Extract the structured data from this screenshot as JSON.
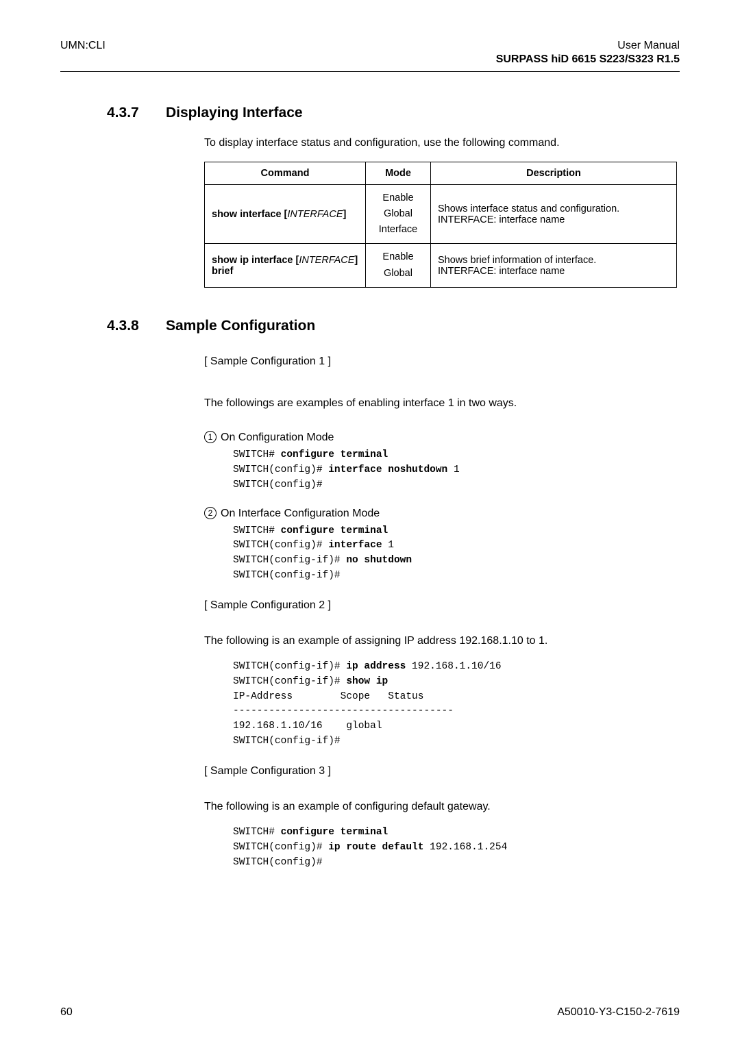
{
  "header": {
    "left": "UMN:CLI",
    "right_top": "User Manual",
    "right_sub": "SURPASS hiD 6615 S223/S323 R1.5"
  },
  "s437": {
    "num": "4.3.7",
    "title": "Displaying Interface",
    "intro": "To display interface status and configuration, use the following command.",
    "th_cmd": "Command",
    "th_mode": "Mode",
    "th_desc": "Description",
    "rows": [
      {
        "cmd_pre": "show interface",
        "cmd_param": "INTERFACE",
        "mode1": "Enable",
        "mode2": "Global",
        "mode3": "Interface",
        "desc1": "Shows interface status and configuration.",
        "desc2": "INTERFACE: interface name"
      },
      {
        "cmd_pre1": "show ip interface",
        "cmd_param": "INTERFACE",
        "cmd_post": "brief",
        "mode1": "Enable",
        "mode2": "Global",
        "desc1": "Shows brief information of interface.",
        "desc2": "INTERFACE: interface name"
      }
    ]
  },
  "s438": {
    "num": "4.3.8",
    "title": "Sample Configuration",
    "s1_label": "[ Sample Configuration 1 ]",
    "s1_intro": "The followings are examples of enabling interface 1 in two ways.",
    "step1_label": "On Configuration Mode",
    "step1_code": {
      "l1p": "SWITCH# ",
      "l1b": "configure terminal",
      "l2p": "SWITCH(config)# ",
      "l2b": "interface noshutdown",
      "l2a": " 1",
      "l3": "SWITCH(config)#"
    },
    "step2_label": "On Interface Configuration Mode",
    "step2_code": {
      "l1p": "SWITCH# ",
      "l1b": "configure terminal",
      "l2p": "SWITCH(config)# ",
      "l2b": "interface",
      "l2a": " 1",
      "l3p": "SWITCH(config-if)# ",
      "l3b": "no shutdown",
      "l4": "SWITCH(config-if)#"
    },
    "s2_label": "[ Sample Configuration 2 ]",
    "s2_intro": "The following is an example of assigning IP address 192.168.1.10 to 1.",
    "s2_code": {
      "l1p": "SWITCH(config-if)# ",
      "l1b": "ip address",
      "l1a": " 192.168.1.10/16",
      "l2p": "SWITCH(config-if)# ",
      "l2b": "show ip",
      "l3": "IP-Address        Scope   Status",
      "l4": "-------------------------------------",
      "l5": "192.168.1.10/16    global",
      "l6": "SWITCH(config-if)#"
    },
    "s3_label": "[ Sample Configuration 3 ]",
    "s3_intro": "The following is an example of configuring default gateway.",
    "s3_code": {
      "l1p": "SWITCH# ",
      "l1b": "configure terminal",
      "l2p": "SWITCH(config)# ",
      "l2b": "ip route default",
      "l2a": " 192.168.1.254",
      "l3": "SWITCH(config)#"
    }
  },
  "footer": {
    "page": "60",
    "doc": "A50010-Y3-C150-2-7619"
  }
}
